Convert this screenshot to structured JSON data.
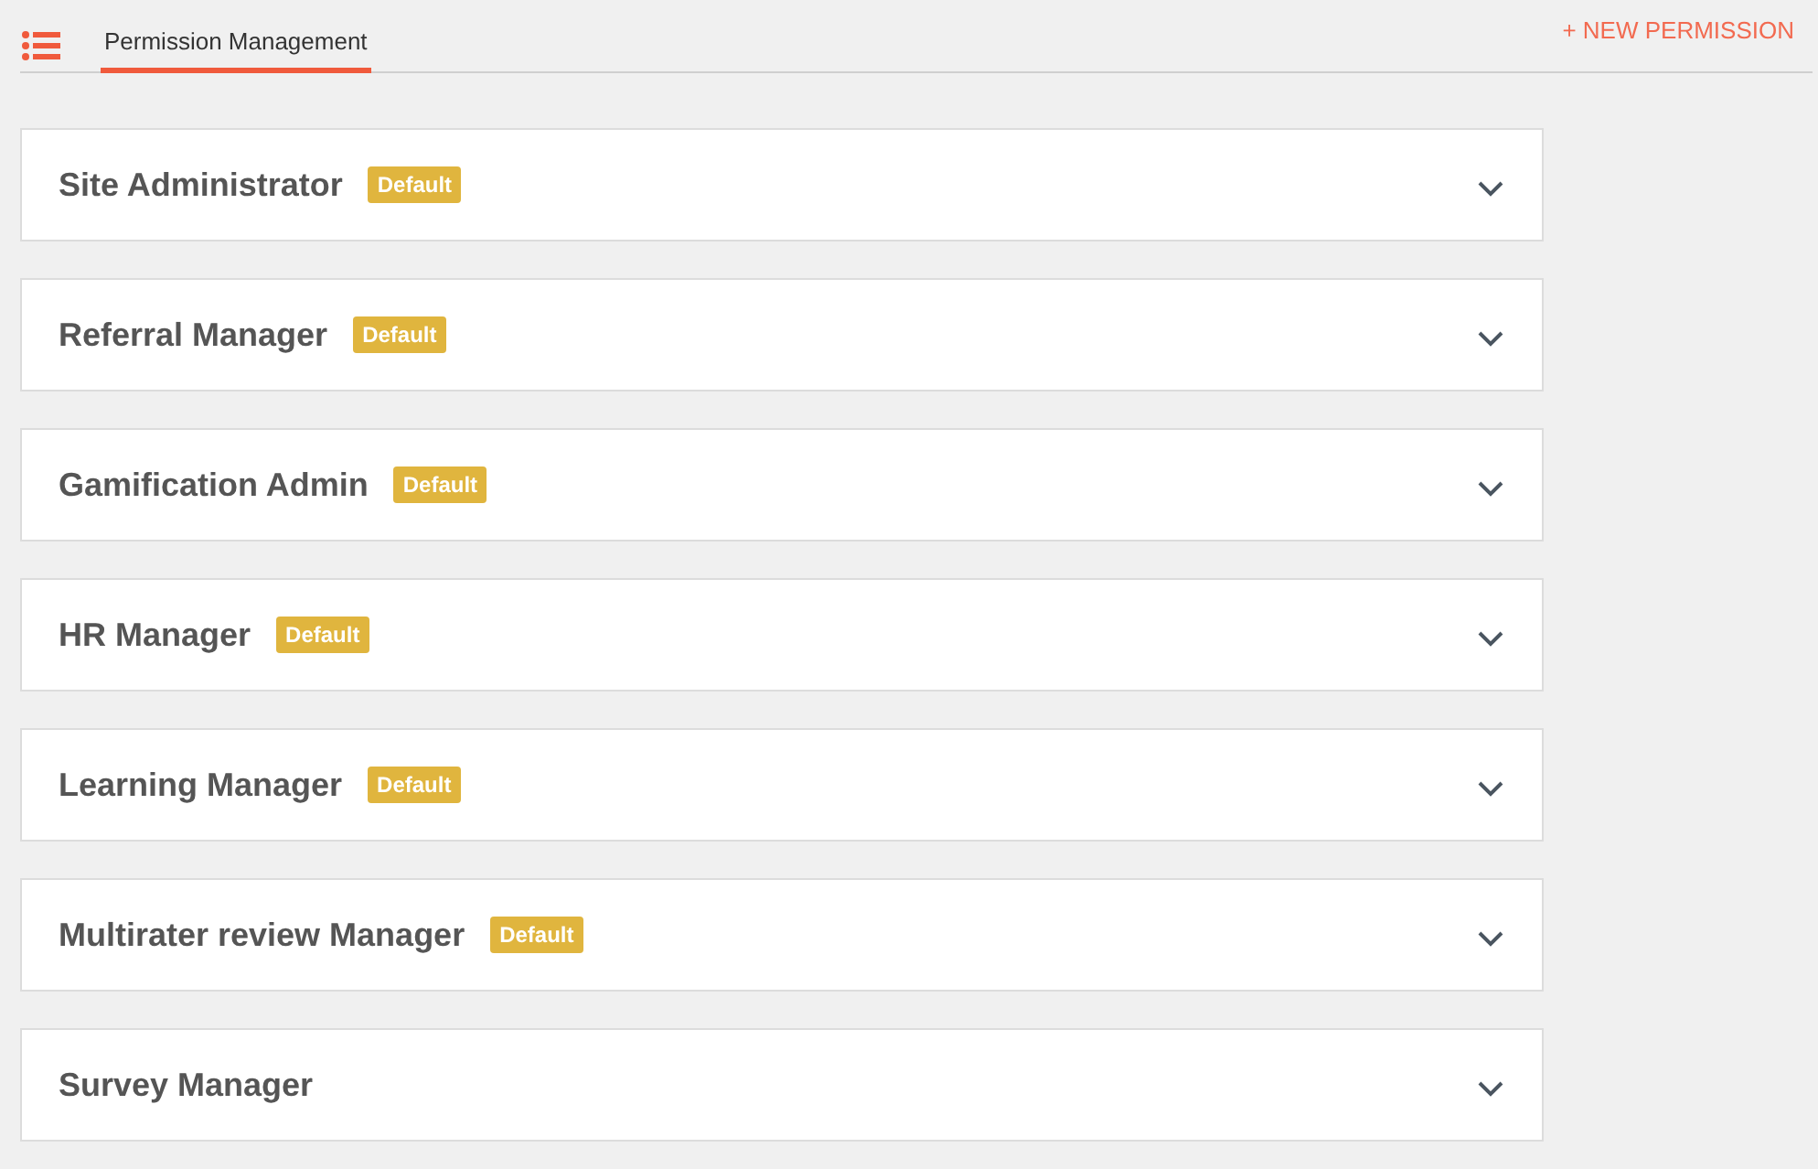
{
  "tabs": [
    {
      "label": "Permission Management",
      "selected": true
    }
  ],
  "new_button": "+ NEW PERMISSION",
  "permissions": [
    {
      "name": "Site Administrator",
      "badge": "Default",
      "expanded": false
    },
    {
      "name": "Referral Manager",
      "badge": "Default",
      "expanded": false
    },
    {
      "name": "Gamification Admin",
      "badge": "Default",
      "expanded": false
    },
    {
      "name": "HR Manager",
      "badge": "Default",
      "expanded": false
    },
    {
      "name": "Learning Manager",
      "badge": "Default",
      "expanded": false
    },
    {
      "name": "Multirater review Manager",
      "badge": "Default",
      "expanded": false
    },
    {
      "name": "Survey Manager",
      "expanded": false
    }
  ]
}
